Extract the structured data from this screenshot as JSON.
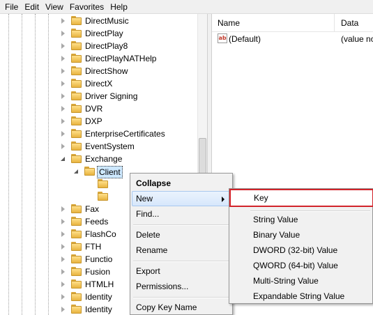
{
  "menubar": {
    "items": [
      "File",
      "Edit",
      "View",
      "Favorites",
      "Help"
    ]
  },
  "tree": {
    "items": [
      {
        "label": "DirectMusic",
        "state": "collapsed"
      },
      {
        "label": "DirectPlay",
        "state": "collapsed"
      },
      {
        "label": "DirectPlay8",
        "state": "collapsed"
      },
      {
        "label": "DirectPlayNATHelp",
        "state": "collapsed"
      },
      {
        "label": "DirectShow",
        "state": "collapsed"
      },
      {
        "label": "DirectX",
        "state": "collapsed"
      },
      {
        "label": "Driver Signing",
        "state": "collapsed"
      },
      {
        "label": "DVR",
        "state": "collapsed"
      },
      {
        "label": "DXP",
        "state": "collapsed"
      },
      {
        "label": "EnterpriseCertificates",
        "state": "collapsed"
      },
      {
        "label": "EventSystem",
        "state": "collapsed"
      },
      {
        "label": "Exchange",
        "state": "expanded"
      },
      {
        "label": "Client",
        "state": "expanded",
        "selected": true
      },
      {
        "label": "",
        "state": "none"
      },
      {
        "label": "",
        "state": "none"
      },
      {
        "label": "Fax",
        "state": "collapsed"
      },
      {
        "label": "Feeds",
        "state": "collapsed"
      },
      {
        "label": "FlashCo",
        "state": "collapsed"
      },
      {
        "label": "FTH",
        "state": "collapsed"
      },
      {
        "label": "Functio",
        "state": "collapsed"
      },
      {
        "label": "Fusion",
        "state": "collapsed"
      },
      {
        "label": "HTMLH",
        "state": "collapsed"
      },
      {
        "label": "Identity",
        "state": "collapsed"
      },
      {
        "label": "Identity",
        "state": "collapsed"
      }
    ]
  },
  "values": {
    "columns": {
      "name": "Name",
      "data": "Data"
    },
    "rows": [
      {
        "icon": "string-value-icon",
        "icon_text": "ab",
        "name": "(Default)",
        "data": "(value no"
      }
    ]
  },
  "context_menu": {
    "collapse": "Collapse",
    "new": "New",
    "find": "Find...",
    "delete": "Delete",
    "rename": "Rename",
    "export": "Export",
    "permissions": "Permissions...",
    "copy_key_name": "Copy Key Name"
  },
  "submenu": {
    "key": "Key",
    "string_value": "String Value",
    "binary_value": "Binary Value",
    "dword": "DWORD (32-bit) Value",
    "qword": "QWORD (64-bit) Value",
    "multi_string": "Multi-String Value",
    "expandable_string": "Expandable String Value"
  },
  "colors": {
    "highlight_border": "#d2232a",
    "menu_bg": "#f1f1f1",
    "folder": "#e8b440"
  }
}
